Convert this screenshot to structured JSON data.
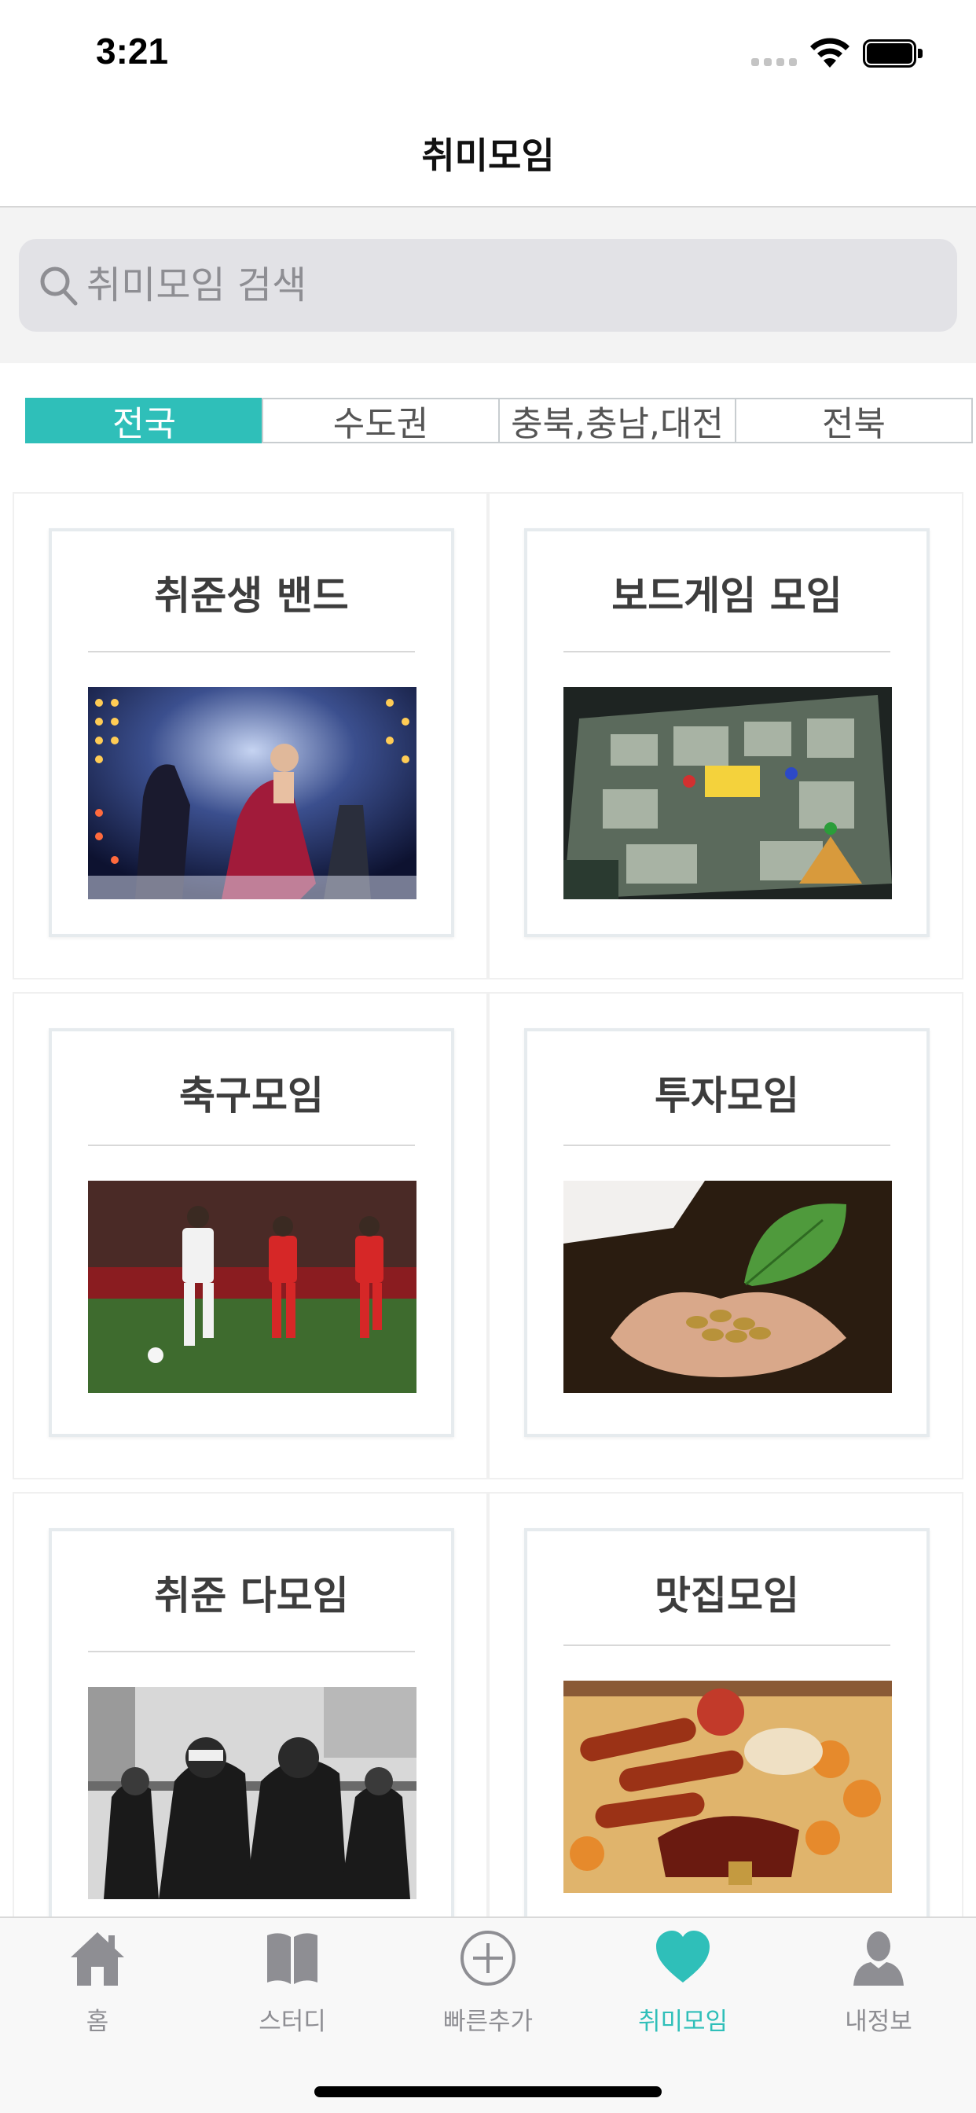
{
  "status_bar": {
    "time": "3:21"
  },
  "nav": {
    "title": "취미모임"
  },
  "search": {
    "placeholder": "취미모임 검색"
  },
  "region_tabs": [
    {
      "label": "전국",
      "active": true
    },
    {
      "label": "수도권",
      "active": false
    },
    {
      "label": "충북,충남,대전",
      "active": false
    },
    {
      "label": "전북",
      "active": false
    }
  ],
  "groups": [
    {
      "title": "취준생 밴드",
      "image": "concert-band-photo"
    },
    {
      "title": "보드게임 모임",
      "image": "board-game-photo"
    },
    {
      "title": "축구모임",
      "image": "soccer-match-photo"
    },
    {
      "title": "투자모임",
      "image": "coins-in-hands-photo"
    },
    {
      "title": "취준 다모임",
      "image": "hiphop-group-photo"
    },
    {
      "title": "맛집모임",
      "image": "grilled-food-photo"
    }
  ],
  "tab_bar": {
    "items": [
      {
        "label": "홈",
        "icon": "home-icon",
        "active": false
      },
      {
        "label": "스터디",
        "icon": "book-icon",
        "active": false
      },
      {
        "label": "빠른추가",
        "icon": "plus-circle-icon",
        "active": false
      },
      {
        "label": "취미모임",
        "icon": "heart-icon",
        "active": true
      },
      {
        "label": "내정보",
        "icon": "person-icon",
        "active": false
      }
    ]
  },
  "colors": {
    "accent": "#2fbfb9",
    "inactive": "#8e8e93"
  }
}
